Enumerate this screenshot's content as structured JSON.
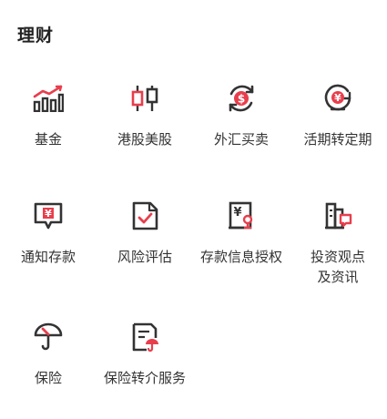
{
  "section": {
    "title": "理财"
  },
  "colors": {
    "accent": "#e83e4c",
    "icon_dark": "#333333",
    "text": "#333333"
  },
  "items": [
    {
      "label": "基金",
      "icon": "fund-chart-icon"
    },
    {
      "label": "港股美股",
      "icon": "candlestick-icon"
    },
    {
      "label": "外汇买卖",
      "icon": "currency-exchange-icon"
    },
    {
      "label": "活期转定期",
      "icon": "yen-clock-icon"
    },
    {
      "label": "通知存款",
      "icon": "deposit-notice-icon"
    },
    {
      "label": "风险评估",
      "icon": "risk-assessment-icon"
    },
    {
      "label": "存款信息授权",
      "icon": "deposit-authorization-icon"
    },
    {
      "label": "投资观点\n及资讯",
      "icon": "investment-news-icon"
    },
    {
      "label": "保险",
      "icon": "umbrella-icon"
    },
    {
      "label": "保险转介服务",
      "icon": "insurance-referral-icon"
    }
  ]
}
